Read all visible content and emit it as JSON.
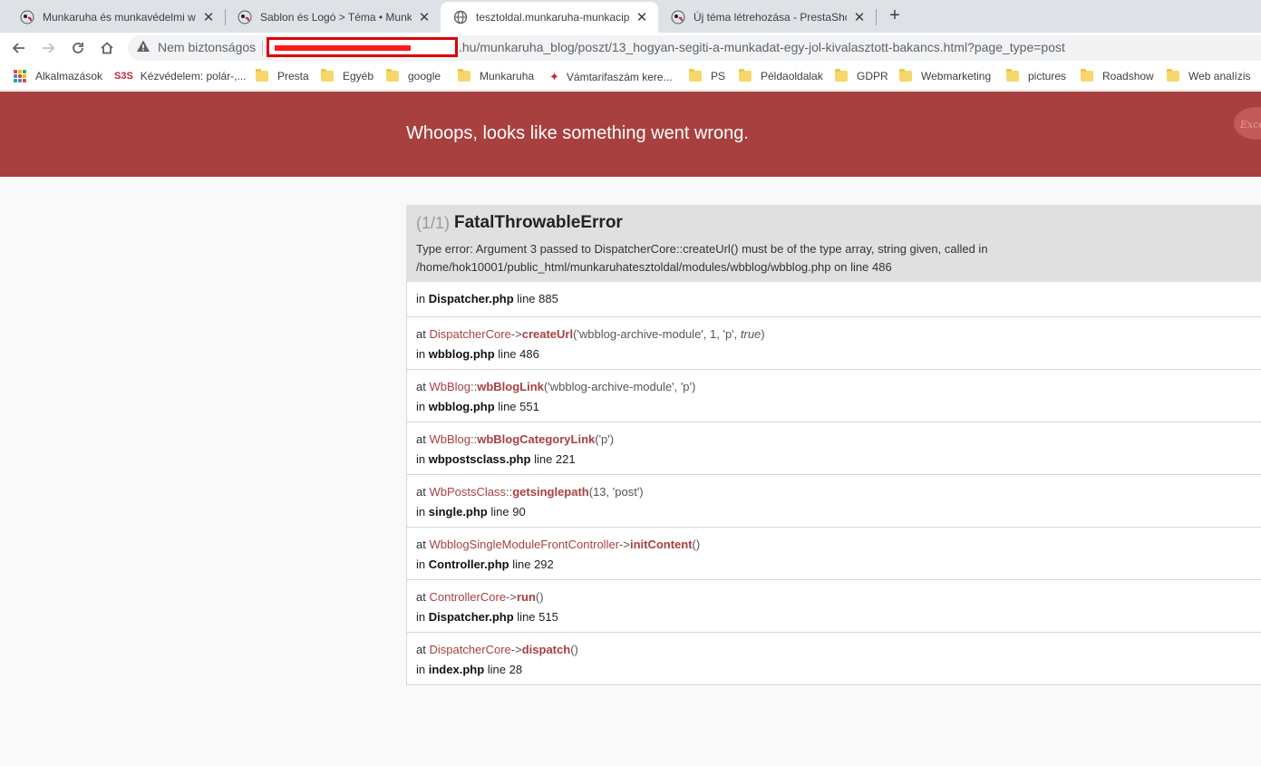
{
  "tabs": [
    {
      "title": "Munkaruha és munkavédelmi we",
      "active": false
    },
    {
      "title": "Sablon és Logó > Téma • Munkar",
      "active": false
    },
    {
      "title": "tesztoldal.munkaruha-munkacipő",
      "active": true
    },
    {
      "title": "Új téma létrehozása - PrestaShop",
      "active": false
    }
  ],
  "toolbar": {
    "security_label": "Nem biztonságos",
    "url_visible": ".hu/munkaruha_blog/poszt/13_hogyan-segiti-a-munkadat-egy-jol-kivalasztott-bakancs.html?page_type=post"
  },
  "bookmarks": [
    {
      "label": "Alkalmazások",
      "icon": "apps-grid-icon"
    },
    {
      "label": "Kézvédelem: polár-,...",
      "icon": "site-logo-icon"
    },
    {
      "label": "Presta",
      "icon": "folder-icon"
    },
    {
      "label": "Egyéb",
      "icon": "folder-icon"
    },
    {
      "label": "google",
      "icon": "folder-icon"
    },
    {
      "label": "Munkaruha",
      "icon": "folder-icon"
    },
    {
      "label": "Vámtarifaszám kere...",
      "icon": "site-logo-icon"
    },
    {
      "label": "PS",
      "icon": "folder-icon"
    },
    {
      "label": "Példaoldalak",
      "icon": "folder-icon"
    },
    {
      "label": "GDPR",
      "icon": "folder-icon"
    },
    {
      "label": "Webmarketing",
      "icon": "folder-icon"
    },
    {
      "label": "pictures",
      "icon": "folder-icon"
    },
    {
      "label": "Roadshow",
      "icon": "folder-icon"
    },
    {
      "label": "Web analízis",
      "icon": "folder-icon"
    }
  ],
  "page": {
    "banner_title": "Whoops, looks like something went wrong.",
    "exception_badge": "Excep",
    "error": {
      "count": "(1/1)",
      "class": "FatalThrowableError",
      "message": "Type error: Argument 3 passed to DispatcherCore::createUrl() must be of the type array, string given, called in /home/hok10001/public_html/munkaruhatesztoldal/modules/wbblog/wbblog.php on line 486"
    },
    "trace_first": {
      "file": "Dispatcher.php",
      "line": "line 885"
    },
    "frames": [
      {
        "class": "DispatcherCore",
        "sep": "->",
        "fn": "createUrl",
        "args_before": "('wbblog-archive-module', 1, 'p', ",
        "args_italic": "true",
        "args_after": ")",
        "file": "wbblog.php",
        "line": "line 486"
      },
      {
        "class": "WbBlog",
        "sep": "::",
        "fn": "wbBlogLink",
        "args_before": "('wbblog-archive-module', 'p')",
        "args_italic": "",
        "args_after": "",
        "file": "wbblog.php",
        "line": "line 551"
      },
      {
        "class": "WbBlog",
        "sep": "::",
        "fn": "wbBlogCategoryLink",
        "args_before": "('p')",
        "args_italic": "",
        "args_after": "",
        "file": "wbpostsclass.php",
        "line": "line 221"
      },
      {
        "class": "WbPostsClass",
        "sep": "::",
        "fn": "getsinglepath",
        "args_before": "(13, 'post')",
        "args_italic": "",
        "args_after": "",
        "file": "single.php",
        "line": "line 90"
      },
      {
        "class": "WbblogSingleModuleFrontController",
        "sep": "->",
        "fn": "initContent",
        "args_before": "()",
        "args_italic": "",
        "args_after": "",
        "file": "Controller.php",
        "line": "line 292"
      },
      {
        "class": "ControllerCore",
        "sep": "->",
        "fn": "run",
        "args_before": "()",
        "args_italic": "",
        "args_after": "",
        "file": "Dispatcher.php",
        "line": "line 515"
      },
      {
        "class": "DispatcherCore",
        "sep": "->",
        "fn": "dispatch",
        "args_before": "()",
        "args_italic": "",
        "args_after": "",
        "file": "index.php",
        "line": "line 28"
      }
    ],
    "labels": {
      "at": "at",
      "in": "in"
    }
  },
  "colors": {
    "banner": "#a94040",
    "accent": "#a94040",
    "redaction": "#e00000"
  }
}
